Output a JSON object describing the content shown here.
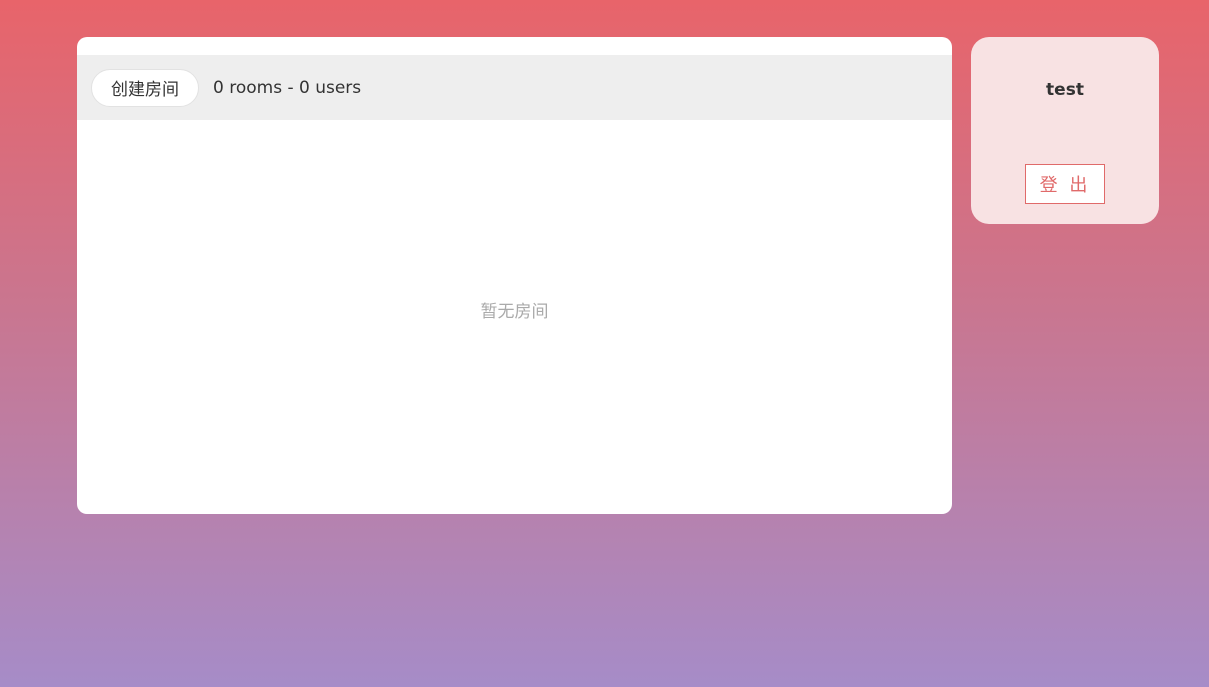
{
  "lobby": {
    "create_room_label": "创建房间",
    "stats_text": "0 rooms - 0 users",
    "empty_text": "暂无房间"
  },
  "user": {
    "name": "test",
    "logout_label": "登 出"
  },
  "colors": {
    "gradient_top": "#e8646a",
    "gradient_bottom": "#a68cc8",
    "accent": "#e06a6a",
    "user_panel_bg": "#f8e2e3"
  }
}
